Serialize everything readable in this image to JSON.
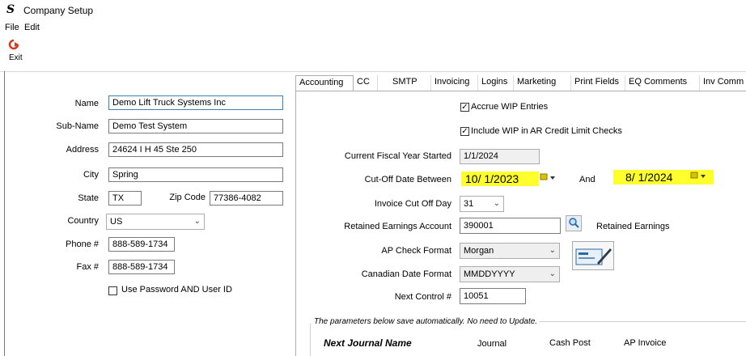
{
  "window": {
    "title": "Company Setup",
    "app_icon": "S"
  },
  "menu": {
    "file": "File",
    "edit": "Edit"
  },
  "toolbar": {
    "exit_label": "Exit"
  },
  "company": {
    "name_label": "Name",
    "name": "Demo Lift Truck Systems Inc",
    "subname_label": "Sub-Name",
    "subname": "Demo Test System",
    "address_label": "Address",
    "address": "24624 I H 45 Ste 250",
    "city_label": "City",
    "city": "Spring",
    "state_label": "State",
    "state": "TX",
    "zip_label": "Zip Code",
    "zip": "77386-4082",
    "country_label": "Country",
    "country": "US",
    "phone_label": "Phone #",
    "phone": "888-589-1734",
    "fax_label": "Fax #",
    "fax": "888-589-1734",
    "use_password_label": "Use Password AND User ID"
  },
  "tabs": [
    "Accounting",
    "CC",
    "SMTP",
    "Invoicing",
    "Logins",
    "Marketing",
    "Print Fields",
    "EQ Comments",
    "Inv Comm"
  ],
  "accounting": {
    "accrue_wip": "Accrue WIP Entries",
    "include_wip": "Include WIP in AR Credit Limit Checks",
    "fiscal_label": "Current Fiscal Year Started",
    "fiscal": "1/1/2024",
    "cutoff_label": "Cut-Off Date Between",
    "cutoff_from": "10/  1/2023",
    "and_label": "And",
    "cutoff_to": "8/  1/2024",
    "invoice_cutoff_label": "Invoice Cut Off Day",
    "invoice_cutoff": "31",
    "retained_label": "Retained Earnings Account",
    "retained_account": "390001",
    "retained_name": "Retained Earnings",
    "ap_check_label": "AP Check Format",
    "ap_check": "Morgan",
    "canadian_label": "Canadian Date Format",
    "canadian": "MMDDYYYY",
    "next_control_label": "Next Control #",
    "next_control": "10051",
    "note": "The parameters below save automatically.  No need to Update.",
    "next_journal_name": "Next Journal Name",
    "col_journal": "Journal",
    "col_cash_post": "Cash Post",
    "col_ap_invoice": "AP Invoice"
  },
  "colors": {
    "highlight": "#ffff2e",
    "exit_icon": "#d63a1e",
    "focus_border": "#3c7fb1"
  }
}
